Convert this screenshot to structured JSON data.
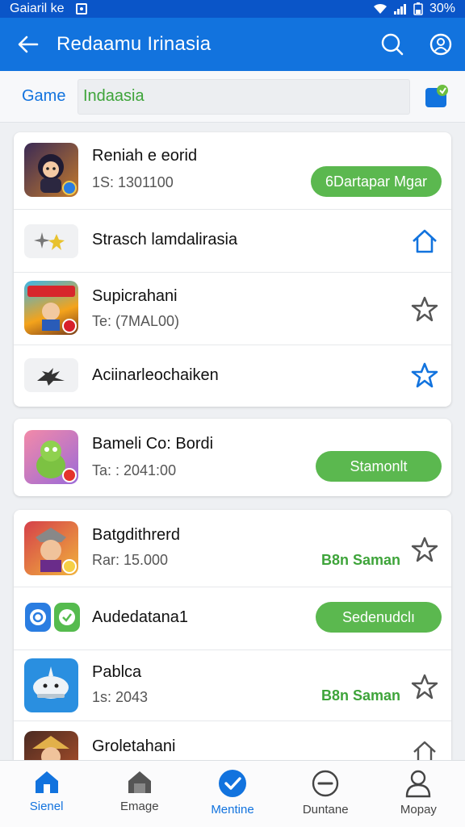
{
  "status": {
    "carrier": "Gaiaril ke",
    "battery": "30%"
  },
  "appbar": {
    "title": "Redaamu Irinasia"
  },
  "search": {
    "scope": "Game",
    "value": "Indaasia"
  },
  "card1": [
    {
      "name": "Reniah e eorid",
      "meta": "1S: 1301100",
      "action": "6Dartapar Mgar"
    },
    {
      "name": "Strasch lamdalirasia"
    },
    {
      "name": "Supicrahani",
      "meta": "Te: (7MAL00)"
    },
    {
      "name": "Aciinarleochaiken"
    }
  ],
  "card2": [
    {
      "name": "Bameli Co: Bordi",
      "meta": "Ta: : 2041:00",
      "action": "Stamonlt"
    }
  ],
  "card3": [
    {
      "name": "Batgdithrerd",
      "meta": "Rar: 15.000",
      "tag": "B8n Saman"
    },
    {
      "name": "Audedatana1",
      "action": "Sedenudclı"
    },
    {
      "name": "Pablca",
      "meta": "1s: 2043",
      "tag": "B8n Saman"
    },
    {
      "name": "Groletahani"
    }
  ],
  "nav": [
    {
      "label": "Sienel"
    },
    {
      "label": "Emage"
    },
    {
      "label": "Mentine"
    },
    {
      "label": "Duntane"
    },
    {
      "label": "Mopay"
    }
  ],
  "colors": {
    "primary": "#1273de",
    "accent_green": "#5bb84f",
    "statusbar": "#0a55c8"
  }
}
